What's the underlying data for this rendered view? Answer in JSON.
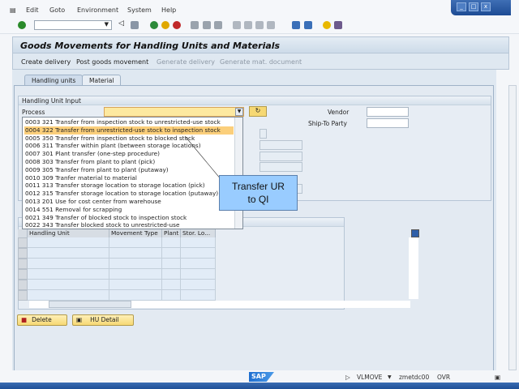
{
  "menu": {
    "items": [
      "Edit",
      "Goto",
      "Environment",
      "System",
      "Help"
    ]
  },
  "window": {
    "minimize": "_",
    "maximize": "□",
    "close": "x"
  },
  "title": "Goods Movements for Handling Units and Materials",
  "app_toolbar": {
    "items": [
      {
        "label": "Create delivery",
        "enabled": true
      },
      {
        "label": "Post goods movement",
        "enabled": true
      },
      {
        "label": "Generate delivery",
        "enabled": false
      },
      {
        "label": "Generate mat. document",
        "enabled": false
      }
    ]
  },
  "tabs": [
    {
      "label": "Handling units",
      "active": true
    },
    {
      "label": "Material",
      "active": false
    }
  ],
  "hu_input": {
    "group_title": "Handling Unit Input",
    "process_label": "Process",
    "process_value": "",
    "vendor_label": "Vendor",
    "ship_to_label": "Ship-To Party"
  },
  "process_dropdown": {
    "selected_index": 1,
    "options": [
      "0003 321 Transfer from inspection stock to unrestricted-use stock",
      "0004 322 Transfer from unrestricted-use stock to inspection stock",
      "0005 350 Transfer from inspection stock to blocked stock",
      "0006 311 Transfer within plant (between storage locations)",
      "0007 301 Plant transfer (one-step procedure)",
      "0008 303 Transfer from plant to plant (pick)",
      "0009 305 Transfer from plant to plant (putaway)",
      "0010 309 Tranfer material to material",
      "0011 313 Transfer storage location to storage location (pick)",
      "0012 315 Transfer storage location to storage location (putaway)",
      "0013 201 Use for cost center from warehouse",
      "0014 551 Removal for scrapping",
      "0021 349 Transfer of blocked stock to inspection stock",
      "0022 343 Transfer blocked stock to unrestricted-use"
    ]
  },
  "callout": {
    "line1": "Transfer UR",
    "line2": "to QI"
  },
  "table": {
    "columns": [
      "Handling Unit",
      "Movement Type",
      "Plant",
      "Stor. Lo..."
    ],
    "rows": 6
  },
  "buttons": {
    "delete": "Delete",
    "hu_detail": "HU Detail"
  },
  "status": {
    "transaction": "VLMOVE",
    "server": "zmetdc00",
    "mode": "OVR",
    "logo": "SAP"
  },
  "colors": {
    "highlight": "#fbcf7b",
    "callout": "#99ccff",
    "button": "#f6d873",
    "required_field": "#fde9a0"
  }
}
